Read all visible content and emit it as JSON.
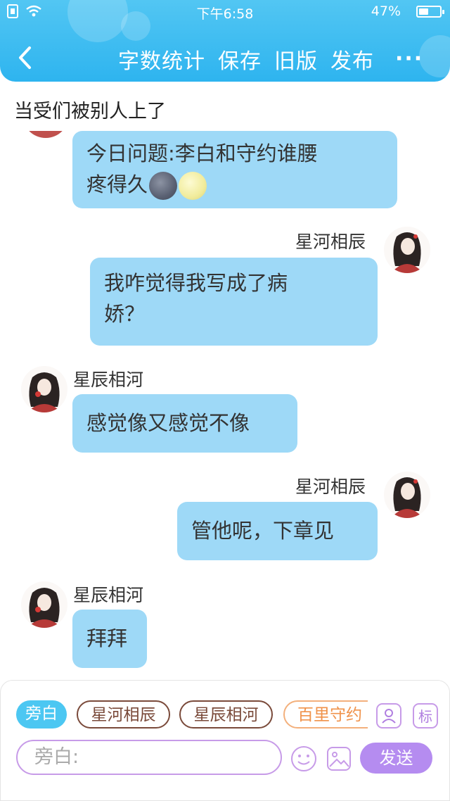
{
  "status_bar": {
    "time": "下午6:58",
    "battery": "47%",
    "battery_level": 0.47
  },
  "nav": {
    "back_icon": "chevron-left-icon",
    "menu": [
      "字数统计",
      "保存",
      "旧版",
      "发布"
    ],
    "more_label": "···"
  },
  "chapter_title": "当受们被别人上了",
  "messages": [
    {
      "line1": "今日问题:李白和守约谁腰",
      "line2": "疼得久",
      "emoji": [
        "new-moon-face-icon",
        "full-moon-face-icon"
      ]
    },
    {
      "sender": "星河相辰",
      "line1": "我咋觉得我写成了病",
      "line2": "娇？"
    },
    {
      "sender": "星辰相河",
      "text": "感觉像又感觉不像"
    },
    {
      "sender": "星河相辰",
      "text": "管他呢，下章见"
    },
    {
      "sender": "星辰相河",
      "text": "拜拜"
    }
  ],
  "composer": {
    "roles": [
      "旁白",
      "星河相辰",
      "星辰相河",
      "百里守约"
    ],
    "avatar_button_icon": "user-card-icon",
    "tag_button": "标",
    "input_placeholder": "旁白:",
    "emoji_icon": "smiley-icon",
    "image_icon": "image-icon",
    "send_label": "发送"
  },
  "colors": {
    "header": "#2eb4ef",
    "bubble": "#9ed9f7",
    "accent_purple": "#b58cf0"
  }
}
